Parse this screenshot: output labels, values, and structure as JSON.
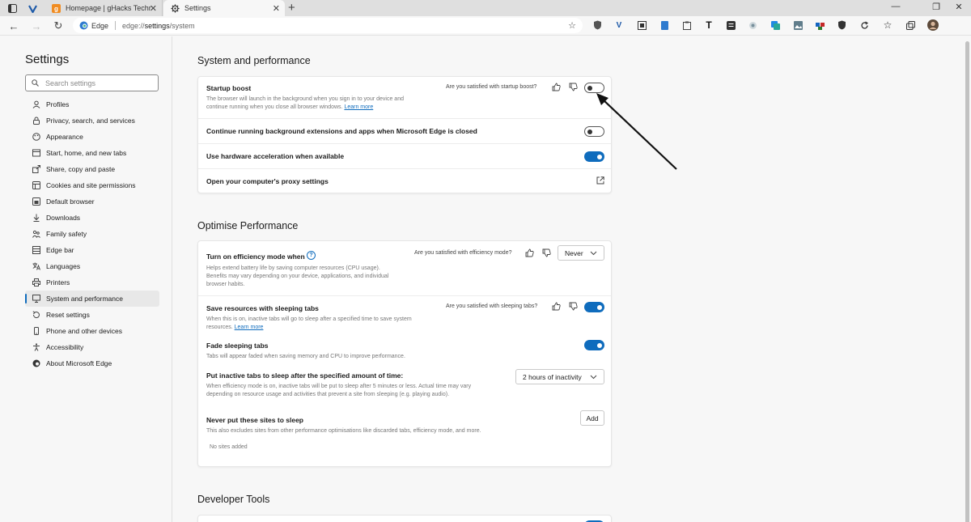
{
  "browser": {
    "tabs": [
      {
        "title": "Homepage | gHacks Technology",
        "favicon": "ghacks-favicon-icon",
        "active": false
      },
      {
        "title": "Settings",
        "favicon": "gear-icon",
        "active": true
      }
    ],
    "address": {
      "site_label": "Edge",
      "url_prefix": "edge://",
      "url_bold": "settings",
      "url_suffix": "/system"
    },
    "extension_icons": [
      "read-aloud-icon",
      "shield-icon",
      "v-icon",
      "screenshot-icon",
      "bookmark-icon",
      "clipboard-icon",
      "T-icon",
      "notes-icon",
      "scan-icon",
      "translate-icon",
      "puzzle-icon",
      "shield-icon",
      "refresh-icon",
      "favorites-icon",
      "collections-icon",
      "profile-avatar"
    ],
    "accent_color": "#0f6cbd"
  },
  "sidebar": {
    "title": "Settings",
    "search_placeholder": "Search settings",
    "items": [
      {
        "label": "Profiles",
        "icon": "profile-icon"
      },
      {
        "label": "Privacy, search, and services",
        "icon": "lock-icon"
      },
      {
        "label": "Appearance",
        "icon": "palette-icon"
      },
      {
        "label": "Start, home, and new tabs",
        "icon": "home-icon"
      },
      {
        "label": "Share, copy and paste",
        "icon": "share-icon"
      },
      {
        "label": "Cookies and site permissions",
        "icon": "cookie-icon"
      },
      {
        "label": "Default browser",
        "icon": "browser-icon"
      },
      {
        "label": "Downloads",
        "icon": "download-icon"
      },
      {
        "label": "Family safety",
        "icon": "family-icon"
      },
      {
        "label": "Edge bar",
        "icon": "edge-bar-icon"
      },
      {
        "label": "Languages",
        "icon": "languages-icon"
      },
      {
        "label": "Printers",
        "icon": "printer-icon"
      },
      {
        "label": "System and performance",
        "icon": "system-icon",
        "active": true
      },
      {
        "label": "Reset settings",
        "icon": "reset-icon"
      },
      {
        "label": "Phone and other devices",
        "icon": "phone-icon"
      },
      {
        "label": "Accessibility",
        "icon": "accessibility-icon"
      },
      {
        "label": "About Microsoft Edge",
        "icon": "edge-icon"
      }
    ]
  },
  "system": {
    "title": "System and performance",
    "startup_boost": {
      "label": "Startup boost",
      "desc1": "The browser will launch in the background when you sign in to your device and",
      "desc2": "continue running when you close all browser windows.",
      "link": "Learn more",
      "feedback": "Are you satisfied with startup boost?",
      "enabled": false
    },
    "background_ext": {
      "label": "Continue running background extensions and apps when Microsoft Edge is closed",
      "enabled": false
    },
    "hw_accel": {
      "label": "Use hardware acceleration when available",
      "enabled": true
    },
    "proxy": {
      "label": "Open your computer's proxy settings"
    }
  },
  "optimise": {
    "title": "Optimise Performance",
    "efficiency": {
      "label": "Turn on efficiency mode when",
      "desc1": "Helps extend battery life by saving computer resources (CPU usage).",
      "desc2": "Benefits may vary depending on your device, applications, and individual",
      "desc3": "browser habits.",
      "feedback": "Are you satisfied with efficiency mode?",
      "value": "Never"
    },
    "sleeping_tabs": {
      "label": "Save resources with sleeping tabs",
      "desc1": "When this is on, inactive tabs will go to sleep after a specified time to save system",
      "desc2": "resources.",
      "link": "Learn more",
      "feedback": "Are you satisfied with sleeping tabs?",
      "enabled": true
    },
    "fade": {
      "label": "Fade sleeping tabs",
      "desc": "Tabs will appear faded when saving memory and CPU to improve performance.",
      "enabled": true
    },
    "inactive": {
      "label": "Put inactive tabs to sleep after the specified amount of time:",
      "desc1": "When efficiency mode is on, inactive tabs will be put to sleep after 5 minutes or less. Actual time may vary",
      "desc2": "depending on resource usage and activities that prevent a site from sleeping (e.g. playing audio).",
      "value": "2 hours of inactivity"
    },
    "never_sleep": {
      "label": "Never put these sites to sleep",
      "desc": "This also excludes sites from other performance optimisations like discarded tabs, efficiency mode, and more.",
      "button": "Add",
      "empty": "No sites added"
    }
  },
  "developer": {
    "title": "Developer Tools"
  }
}
